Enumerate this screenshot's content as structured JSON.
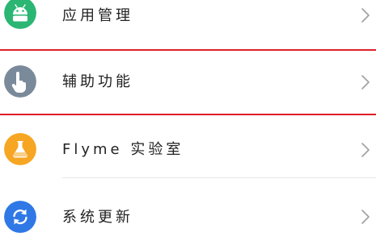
{
  "settings": {
    "items": [
      {
        "label": "应用管理",
        "icon": "android-icon",
        "icon_color": "#2bb673"
      },
      {
        "label": "辅助功能",
        "icon": "hand-pointer-icon",
        "icon_color": "#7b8a9a"
      },
      {
        "label": "Flyme 实验室",
        "icon": "flask-icon",
        "icon_color": "#f6a623"
      },
      {
        "label": "系统更新",
        "icon": "refresh-icon",
        "icon_color": "#2f78e6"
      }
    ],
    "highlighted_item": "辅助功能",
    "highlight_color": "#e01e2a",
    "chevron_icon": "chevron-right-icon"
  }
}
